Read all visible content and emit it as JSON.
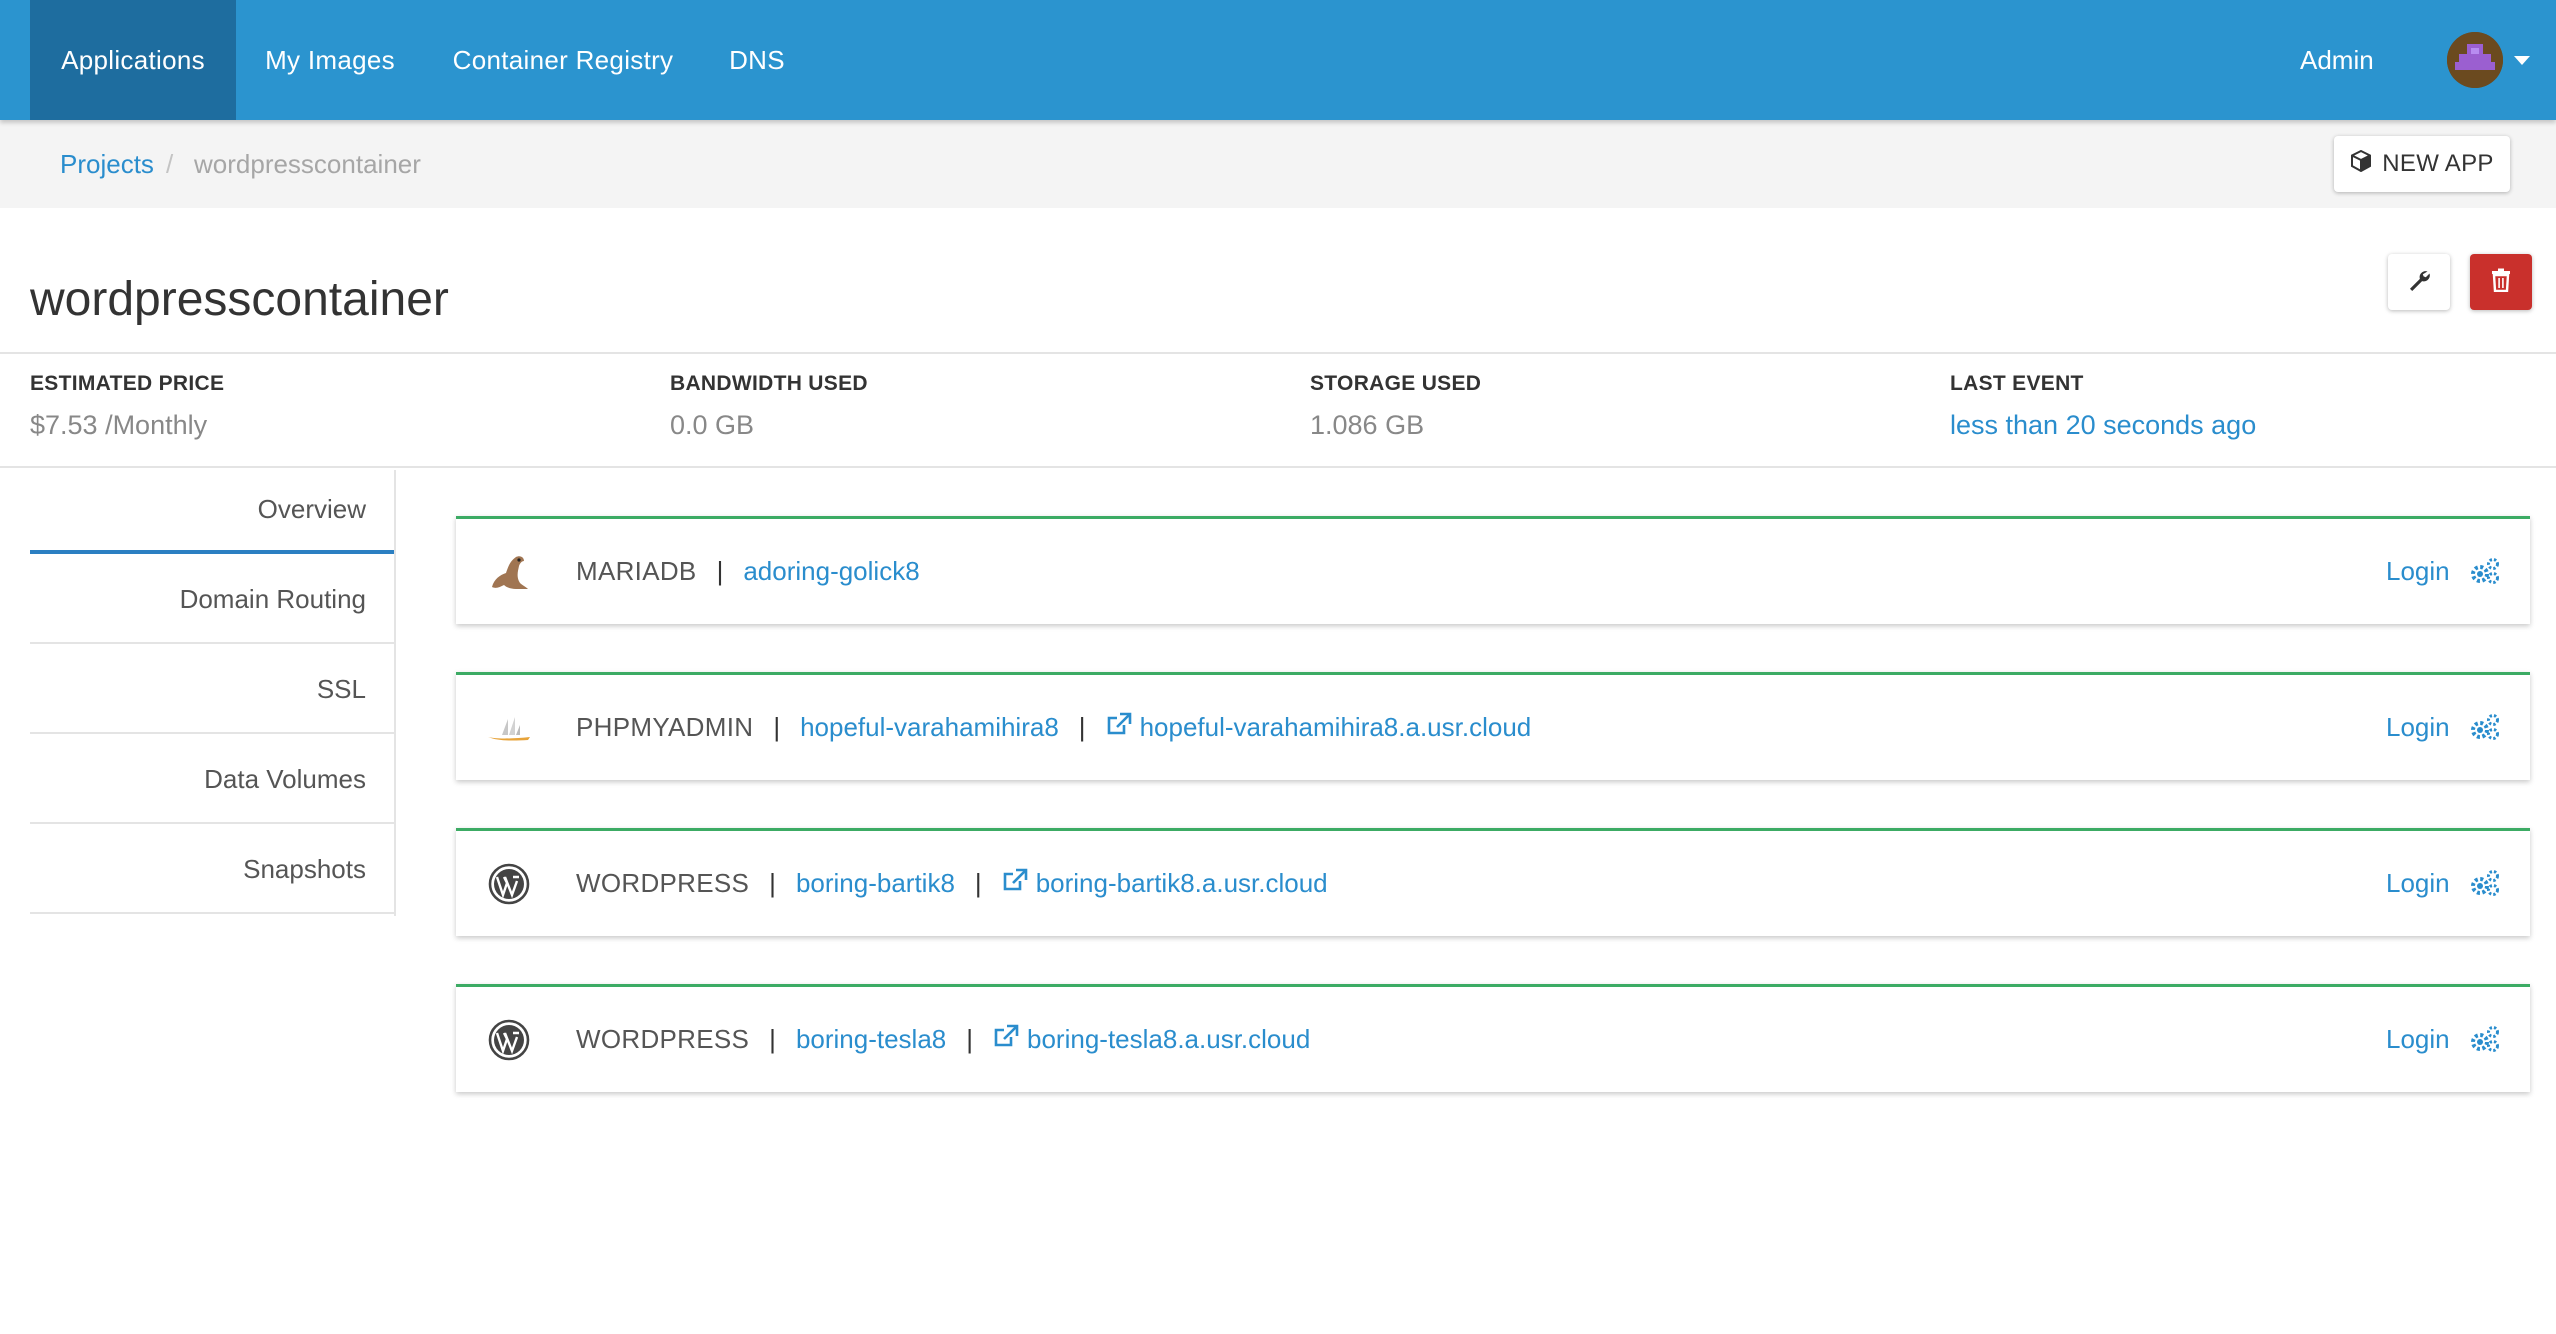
{
  "nav": {
    "tabs": [
      {
        "label": "Applications",
        "active": true
      },
      {
        "label": "My Images",
        "active": false
      },
      {
        "label": "Container Registry",
        "active": false
      },
      {
        "label": "DNS",
        "active": false
      }
    ],
    "admin_label": "Admin",
    "avatar_icon": "avatar-icon"
  },
  "breadcrumb": {
    "root": "Projects",
    "separator": "/",
    "current": "wordpresscontainer"
  },
  "new_app_label": "NEW APP",
  "project": {
    "title": "wordpresscontainer"
  },
  "stats": [
    {
      "label": "ESTIMATED PRICE",
      "value": "$7.53 /Monthly"
    },
    {
      "label": "BANDWIDTH USED",
      "value": "0.0 GB"
    },
    {
      "label": "STORAGE USED",
      "value": "1.086 GB"
    },
    {
      "label": "LAST EVENT",
      "value": "less than 20 seconds ago"
    }
  ],
  "side_tabs": [
    {
      "label": "Overview",
      "active": true
    },
    {
      "label": "Domain Routing",
      "active": false
    },
    {
      "label": "SSL",
      "active": false
    },
    {
      "label": "Data Volumes",
      "active": false
    },
    {
      "label": "Snapshots",
      "active": false
    }
  ],
  "apps": [
    {
      "type": "MARIADB",
      "name": "adoring-golick8",
      "url": "",
      "icon": "mariadb-seal-icon",
      "login": "Login"
    },
    {
      "type": "PHPMYADMIN",
      "name": "hopeful-varahamihira8",
      "url": "hopeful-varahamihira8.a.usr.cloud",
      "icon": "phpmyadmin-sail-icon",
      "login": "Login"
    },
    {
      "type": "WORDPRESS",
      "name": "boring-bartik8",
      "url": "boring-bartik8.a.usr.cloud",
      "icon": "wordpress-icon",
      "login": "Login"
    },
    {
      "type": "WORDPRESS",
      "name": "boring-tesla8",
      "url": "boring-tesla8.a.usr.cloud",
      "icon": "wordpress-icon",
      "login": "Login"
    }
  ],
  "colors": {
    "nav_bg": "#2b94cf",
    "nav_active": "#1e6d9f",
    "link": "#2a8dcd",
    "card_accent": "#3cab64",
    "danger": "#c9302c"
  }
}
